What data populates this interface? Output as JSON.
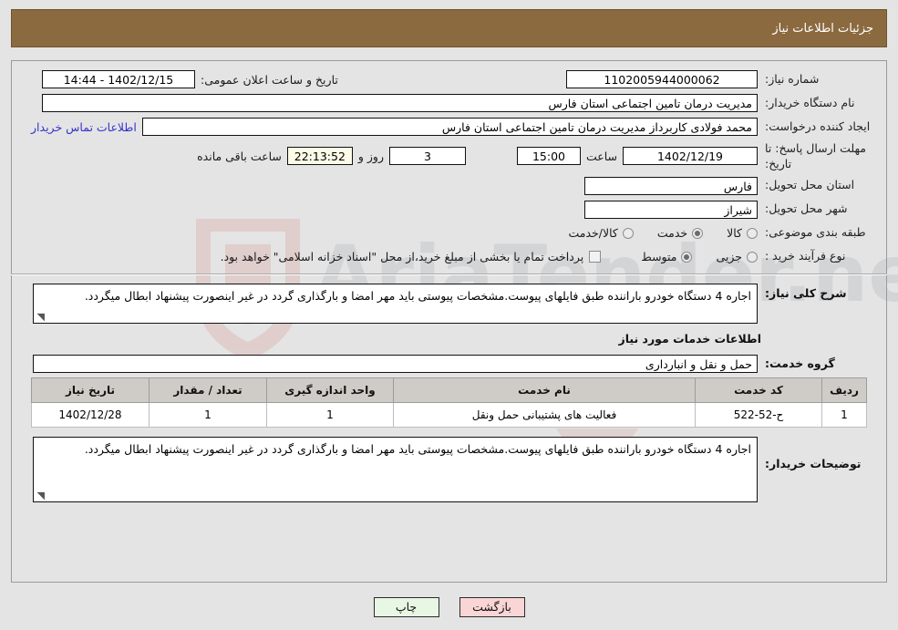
{
  "header": {
    "title": "جزئیات اطلاعات نیاز"
  },
  "form": {
    "need_number_label": "شماره نیاز:",
    "need_number_value": "1102005944000062",
    "announce_label": "تاریخ و ساعت اعلان عمومی:",
    "announce_value": "1402/12/15 - 14:44",
    "buyer_org_label": "نام دستگاه خریدار:",
    "buyer_org_value": "مدیریت درمان تامین اجتماعی استان فارس",
    "requester_label": "ایجاد کننده درخواست:",
    "requester_value": "محمد فولادی کاربرداز مدیریت درمان تامین اجتماعی استان فارس",
    "contact_link": "اطلاعات تماس خریدار",
    "deadline_label": "مهلت ارسال پاسخ: تا تاریخ:",
    "deadline_date": "1402/12/19",
    "hour_label": "ساعت",
    "deadline_time": "15:00",
    "days_value": "3",
    "days_label": "روز و",
    "countdown_value": "22:13:52",
    "remaining_label": "ساعت باقی مانده",
    "province_label": "استان محل تحویل:",
    "province_value": "فارس",
    "city_label": "شهر محل تحویل:",
    "city_value": "شیراز",
    "category_label": "طبقه بندی موضوعی:",
    "category_options": [
      {
        "label": "کالا",
        "selected": false
      },
      {
        "label": "خدمت",
        "selected": true
      },
      {
        "label": "کالا/خدمت",
        "selected": false
      }
    ],
    "process_label": "نوع فرآیند خرید :",
    "process_options": [
      {
        "label": "جزیی",
        "selected": false
      },
      {
        "label": "متوسط",
        "selected": true
      }
    ],
    "payment_checkbox_checked": false,
    "payment_note": "پرداخت تمام یا بخشی از مبلغ خرید،از محل \"اسناد خزانه اسلامی\" خواهد بود."
  },
  "description": {
    "label": "شرح کلی نیاز:",
    "value": "اجاره 4 دستگاه خودرو باراننده طبق فایلهای پیوست.مشخصات پیوستی باید مهر امضا و بارگذاری گردد در غیر اینصورت پیشنهاد ابطال میگردد."
  },
  "services_section": {
    "title": "اطلاعات خدمات مورد نیاز",
    "group_label": "گروه خدمت:",
    "group_value": "حمل و نقل و انبارداری"
  },
  "table": {
    "columns": [
      "ردیف",
      "کد خدمت",
      "نام خدمت",
      "واحد اندازه گیری",
      "تعداد / مقدار",
      "تاریخ نیاز"
    ],
    "rows": [
      {
        "row_no": "1",
        "service_code": "ح-52-522",
        "service_name": "فعالیت های پشتیبانی حمل ونقل",
        "unit": "1",
        "quantity": "1",
        "need_date": "1402/12/28"
      }
    ]
  },
  "buyer_notes": {
    "label": "توضیحات خریدار:",
    "value": "اجاره 4 دستگاه خودرو باراننده طبق فایلهای پیوست.مشخصات پیوستی باید مهر امضا و بارگذاری گردد در غیر اینصورت پیشنهاد ابطال میگردد."
  },
  "footer": {
    "back_label": "بازگشت",
    "print_label": "چاپ"
  },
  "watermark": {
    "text": "AriaTender.net"
  },
  "colors": {
    "header_bg": "#8b6a3f",
    "page_bg": "#e4e4e4",
    "link": "#3333cc",
    "timer_bg": "#fbfbe8",
    "back_btn_bg": "#fad5d5",
    "print_btn_bg": "#e8f6e4",
    "table_header_bg": "#cfcbc6",
    "service_name_text": "#6b4a1f"
  }
}
